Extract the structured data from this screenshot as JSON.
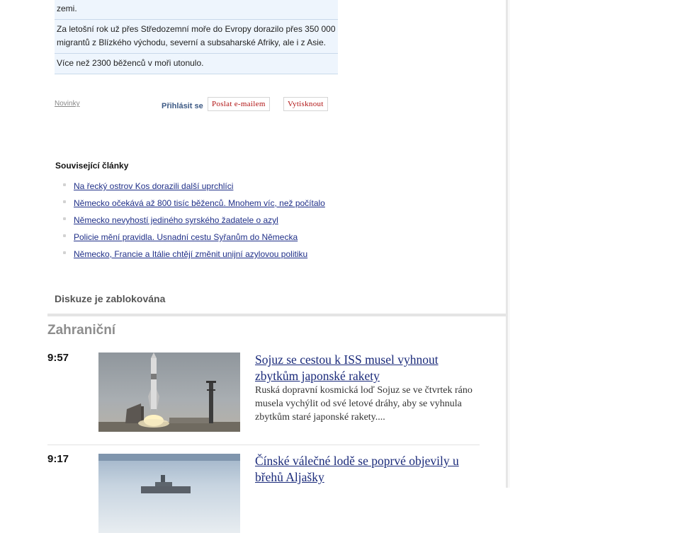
{
  "facts": [
    "zemi.",
    "Za letošní rok už přes Středozemní moře do Evropy dorazilo přes 350 000 migrantů z Blízkého východu, severní a subsaharské Afriky, ale i z Asie.",
    "Více než 2300 běženců v moři utonulo."
  ],
  "tools": {
    "source": "Novinky",
    "login": "Přihlásit se",
    "email": "Poslat e-mailem",
    "print": "Vytisknout"
  },
  "related": {
    "title": "Související články",
    "items": [
      "Na řecký ostrov Kos dorazili další uprchlíci",
      "Německo očekává až 800 tisíc běženců. Mnohem víc, než počítalo",
      "Německo nevyhostí jediného syrského žadatele o azyl",
      "Policie mění pravidla. Usnadní cestu Syřanům do Německa",
      "Německo, Francie a Itálie chtějí změnit unijní azylovou politiku"
    ]
  },
  "discussion": "Diskuze je zablokována",
  "section": "Zahraniční",
  "articles": [
    {
      "time": "9:57",
      "headline": "Sojuz se cestou k ISS musel vyhnout zbytkům japonské rakety",
      "perex": "Ruská dopravní kosmická loď Sojuz se ve čtvrtek ráno musela vychýlit od své letové dráhy, aby se vyhnula zbytkům staré japonské rakety...."
    },
    {
      "time": "9:17",
      "headline": "Čínské válečné lodě se poprvé objevily u břehů Aljašky"
    }
  ]
}
